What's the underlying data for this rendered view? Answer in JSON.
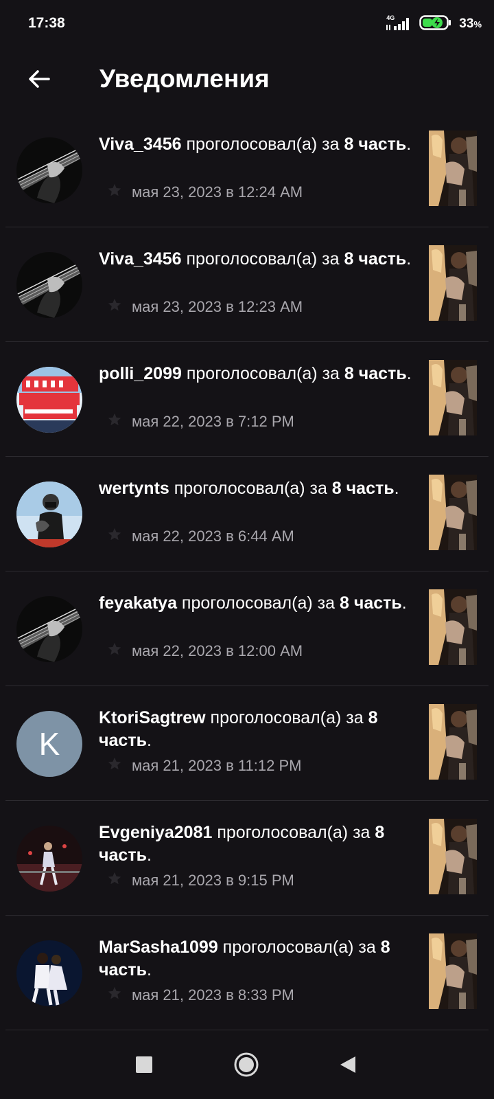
{
  "status_bar": {
    "time": "17:38",
    "network": "4G",
    "battery_percent": "33",
    "battery_unit": "%"
  },
  "header": {
    "title": "Уведомления"
  },
  "notifications": [
    {
      "username": "Viva_3456",
      "action": " проголосовал(а) за ",
      "part_number": "8",
      "part_word": "часть",
      "timestamp": "мая 23, 2023 в 12:24 AM",
      "avatar_type": "guitar"
    },
    {
      "username": "Viva_3456",
      "action": " проголосовал(а) за ",
      "part_number": "8",
      "part_word": "часть",
      "timestamp": "мая 23, 2023 в 12:23 AM",
      "avatar_type": "guitar"
    },
    {
      "username": "polli_2099",
      "action": " проголосовал(а) за ",
      "part_number": "8",
      "part_word": "часть",
      "timestamp": "мая 22, 2023 в 7:12 PM",
      "avatar_type": "logo"
    },
    {
      "username": "wertynts",
      "action": " проголосовал(а) за ",
      "part_number": "8",
      "part_word": "часть",
      "timestamp": "мая 22, 2023 в 6:44 AM",
      "avatar_type": "person-blue"
    },
    {
      "username": "feyakatya",
      "action": " проголосовал(а) за ",
      "part_number": "8",
      "part_word": "часть",
      "timestamp": "мая 22, 2023 в 12:00 AM",
      "avatar_type": "guitar"
    },
    {
      "username": "KtoriSagtrew",
      "action": " проголосовал(а) за ",
      "part_number": "8",
      "part_word": "часть",
      "timestamp": "мая 21, 2023 в 11:12 PM",
      "avatar_type": "letter",
      "avatar_letter": "K"
    },
    {
      "username": "Evgeniya2081",
      "action": " проголосовал(а) за ",
      "part_number": "8",
      "part_word": "часть",
      "timestamp": "мая 21, 2023 в 9:15 PM",
      "avatar_type": "skater-dark"
    },
    {
      "username": "MarSasha1099",
      "action": " проголосовал(а) за ",
      "part_number": "8",
      "part_word": "часть",
      "timestamp": "мая 21, 2023 в 8:33 PM",
      "avatar_type": "skaters-pair"
    }
  ],
  "colors": {
    "background": "#141216",
    "divider": "#2d2b30",
    "secondary_text": "#a9a7ad",
    "letter_avatar": "#7e93a6"
  }
}
